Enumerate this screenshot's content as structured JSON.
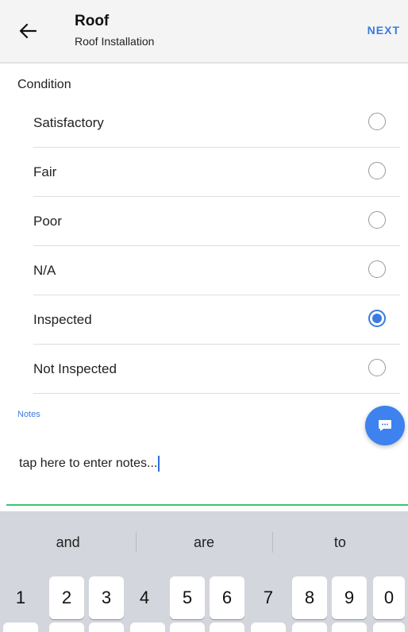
{
  "header": {
    "back_icon": "arrow-left-icon",
    "title": "Roof",
    "subtitle": "Roof Installation",
    "next_label": "NEXT"
  },
  "condition": {
    "label": "Condition",
    "options": [
      {
        "label": "Satisfactory",
        "selected": false
      },
      {
        "label": "Fair",
        "selected": false
      },
      {
        "label": "Poor",
        "selected": false
      },
      {
        "label": "N/A",
        "selected": false
      },
      {
        "label": "Inspected",
        "selected": true
      },
      {
        "label": "Not Inspected",
        "selected": false
      }
    ]
  },
  "notes": {
    "label": "Notes",
    "value": "tap here to enter notes...",
    "fab_icon": "chat-bubble-icon"
  },
  "keyboard": {
    "suggestions": [
      "and",
      "are",
      "to"
    ],
    "number_keys": [
      "1",
      "2",
      "3",
      "4",
      "5",
      "6",
      "7",
      "8",
      "9",
      "0"
    ]
  },
  "colors": {
    "accent": "#3b7ae0",
    "focus_underline": "#3cc46e",
    "header_bg": "#f4f4f4",
    "keyboard_bg": "#d3d6dc"
  }
}
